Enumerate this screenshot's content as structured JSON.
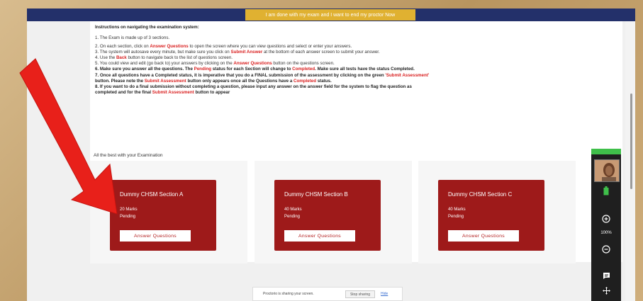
{
  "topbar": {
    "end_button": "I am done with my exam and I want to end my proctor Now"
  },
  "instructions": {
    "title": "Instructions on navigating the examination system:",
    "items": [
      {
        "bold": false,
        "parts": [
          {
            "t": "1. The Exam is made up of 3 sections."
          }
        ]
      },
      {
        "bold": false,
        "parts": [
          {
            "t": "2. On each section, click on "
          },
          {
            "t": "Answer Questions",
            "red": true
          },
          {
            "t": " to open the screen where  you can view questions and select or enter your answers."
          }
        ]
      },
      {
        "bold": false,
        "parts": [
          {
            "t": "3. The system will autosave every minute, but make sure you click on "
          },
          {
            "t": "Submit Answer",
            "red": true
          },
          {
            "t": " at the bottom of each answer screen to submit your answer."
          }
        ]
      },
      {
        "bold": false,
        "parts": [
          {
            "t": "4. Use the "
          },
          {
            "t": "Back",
            "red": true
          },
          {
            "t": " button to navigate back to the list of questions screen."
          }
        ]
      },
      {
        "bold": false,
        "parts": [
          {
            "t": "5. You could view and edit (go back to) your answers by clicking on the "
          },
          {
            "t": "Answer Questions",
            "red": true
          },
          {
            "t": " button on the questions screen."
          }
        ]
      },
      {
        "bold": true,
        "parts": [
          {
            "t": "6. Make sure you answer all the questions. The "
          },
          {
            "t": "Pending",
            "red": true
          },
          {
            "t": " status for each Section will change to "
          },
          {
            "t": "Completed",
            "red": true
          },
          {
            "t": ". Make sure all tests have the status Completed."
          }
        ]
      },
      {
        "bold": true,
        "parts": [
          {
            "t": "7. Once all questions have a Completed status, it is imperative that you do a FINAL submission of the assessment by clicking on the green "
          },
          {
            "t": "'Submit Assessment'",
            "red": true
          }
        ]
      },
      {
        "bold": true,
        "parts": [
          {
            "t": "    button. Please note the "
          },
          {
            "t": "Submit Assessment",
            "red": true
          },
          {
            "t": " button only appears once all the Questions have a "
          },
          {
            "t": "Completed",
            "red": true
          },
          {
            "t": " status."
          }
        ]
      },
      {
        "bold": true,
        "parts": [
          {
            "t": "8. If you want to do a final submission without completing a question, please input any answer on the answer field for the system to flag the question as"
          }
        ]
      },
      {
        "bold": true,
        "parts": [
          {
            "t": "    completed and for the final "
          },
          {
            "t": "Submit Assessment",
            "red": true
          },
          {
            "t": " button to appear"
          }
        ]
      }
    ]
  },
  "best_wishes": "All the best with your Examination",
  "sections": [
    {
      "title": "Dummy CHSM Section A",
      "marks": "20 Marks",
      "status": "Pending",
      "button": "Answer Questions"
    },
    {
      "title": "Dummy CHSM Section B",
      "marks": "40 Marks",
      "status": "Pending",
      "button": "Answer Questions"
    },
    {
      "title": "Dummy CHSM Section C",
      "marks": "40 Marks",
      "status": "Pending",
      "button": "Answer Questions"
    }
  ],
  "proctor_bar": {
    "message": "Proctorio is sharing your screen.",
    "stop": "Stop sharing",
    "hide": "Hide"
  },
  "side_panel": {
    "zoom": "100%"
  },
  "colors": {
    "topbar": "#23306a",
    "end_button": "#e0b131",
    "card": "#9e1a1a",
    "highlight": "#d92020",
    "arrow": "#e8201a",
    "panel_header": "#3fbf4a"
  },
  "icons": [
    "battery-icon",
    "zoom-in-icon",
    "zoom-out-icon",
    "chat-icon",
    "move-icon",
    "red-arrow"
  ]
}
